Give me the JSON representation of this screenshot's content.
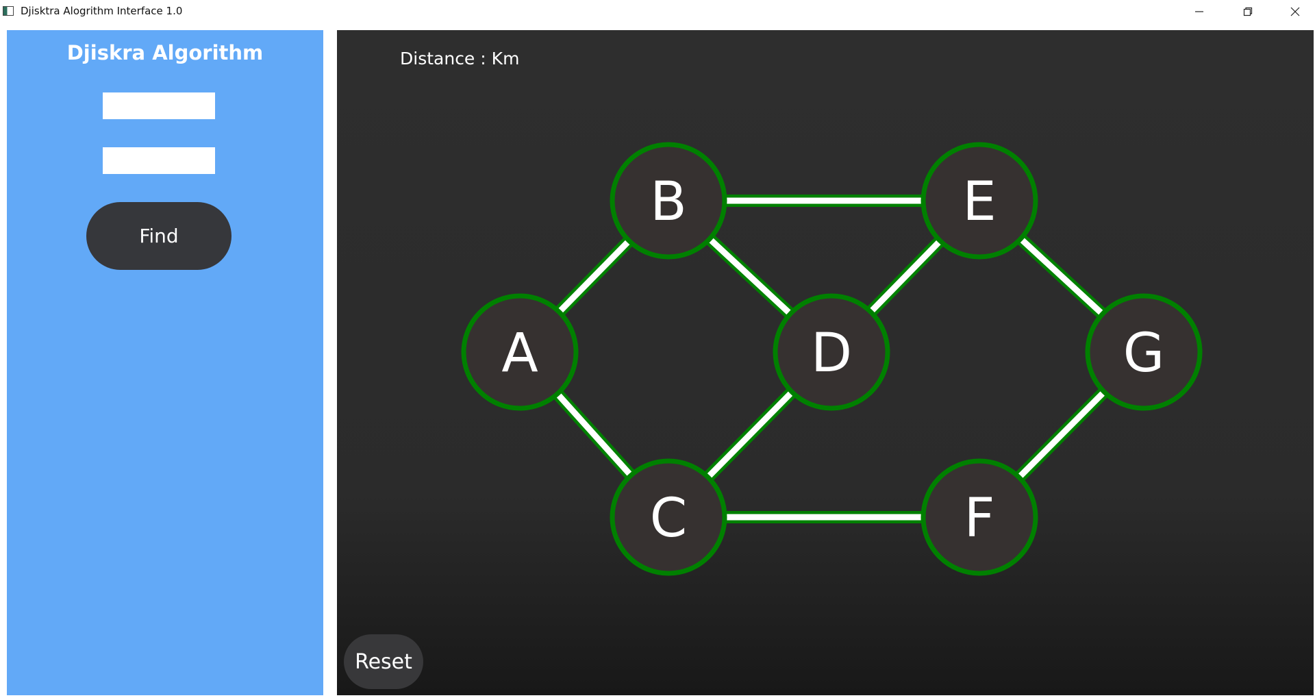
{
  "window": {
    "title": "Djisktra Alogrithm Interface 1.0",
    "controls": [
      "minimize-icon",
      "restore-icon",
      "close-icon"
    ]
  },
  "left_panel": {
    "title": "Djiskra Algorithm",
    "source_input": {
      "value": "",
      "placeholder": ""
    },
    "target_input": {
      "value": "",
      "placeholder": ""
    },
    "find_label": "Find"
  },
  "graph_panel": {
    "distance_label": "Distance",
    "distance_separator": ":",
    "distance_value": "",
    "distance_unit": "Km",
    "reset_label": "Reset",
    "nodes": [
      {
        "id": "A",
        "label": "A"
      },
      {
        "id": "B",
        "label": "B"
      },
      {
        "id": "C",
        "label": "C"
      },
      {
        "id": "D",
        "label": "D"
      },
      {
        "id": "E",
        "label": "E"
      },
      {
        "id": "F",
        "label": "F"
      },
      {
        "id": "G",
        "label": "G"
      }
    ],
    "edges": [
      [
        "A",
        "B"
      ],
      [
        "A",
        "C"
      ],
      [
        "B",
        "D"
      ],
      [
        "C",
        "D"
      ],
      [
        "B",
        "E"
      ],
      [
        "C",
        "F"
      ],
      [
        "D",
        "E"
      ],
      [
        "E",
        "G"
      ],
      [
        "F",
        "G"
      ]
    ]
  },
  "colors": {
    "panel_blue": "#62a9f7",
    "button_dark": "#36373b",
    "graph_bg": "#2e2e2e",
    "node_fill": "#363130",
    "node_border": "#008000",
    "edge_outer": "#008000",
    "edge_inner": "#ffffff",
    "text_white": "#ffffff"
  }
}
